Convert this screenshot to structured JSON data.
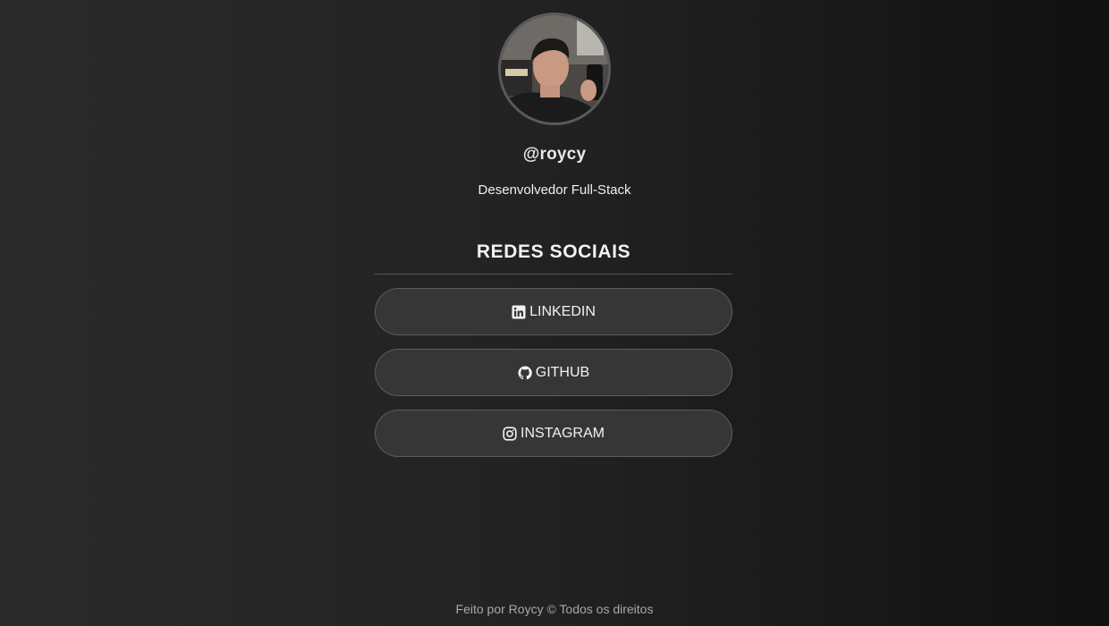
{
  "profile": {
    "username": "@roycy",
    "bio": "Desenvolvedor Full-Stack"
  },
  "social": {
    "title": "REDES SOCIAIS",
    "links": [
      {
        "label": "LINKEDIN",
        "icon": "linkedin-icon"
      },
      {
        "label": "GITHUB",
        "icon": "github-icon"
      },
      {
        "label": "INSTAGRAM",
        "icon": "instagram-icon"
      }
    ]
  },
  "footer": {
    "text": "Feito por Roycy © Todos os direitos"
  },
  "colors": {
    "background_left": "#2a2a2a",
    "background_right": "#111111",
    "button_bg": "#363636",
    "button_border": "#5c5c5c",
    "text": "#f2f2f2"
  }
}
